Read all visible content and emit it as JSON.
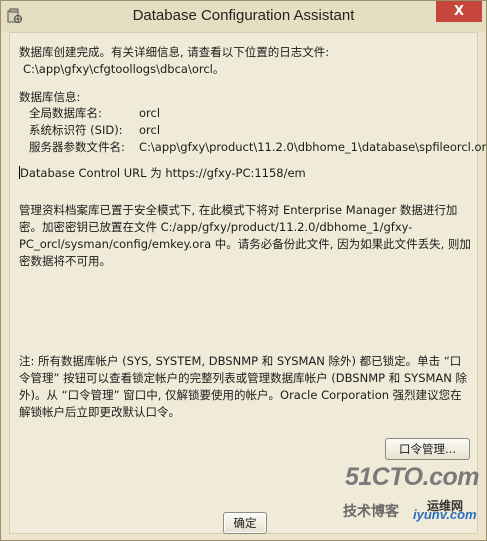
{
  "window": {
    "title": "Database Configuration Assistant",
    "close_glyph": "X"
  },
  "message": {
    "complete": "数据库创建完成。有关详细信息, 请查看以下位置的日志文件:",
    "log_path": "C:\\app\\gfxy\\cfgtoollogs\\dbca\\orcl。",
    "db_info_heading": "数据库信息:",
    "global_db_name_label": "全局数据库名:",
    "global_db_name_value": "orcl",
    "sid_label": "系统标识符 (SID):",
    "sid_value": "orcl",
    "spfile_label": "服务器参数文件名:",
    "spfile_value": "C:\\app\\gfxy\\product\\11.2.0\\dbhome_1\\database\\spfileorcl.ora",
    "em_url": "Database Control URL 为 https://gfxy-PC:1158/em",
    "repository_note": "管理资料档案库已置于安全模式下, 在此模式下将对 Enterprise Manager 数据进行加密。加密密钥已放置在文件 C:/app/gfxy/product/11.2.0/dbhome_1/gfxy-PC_orcl/sysman/config/emkey.ora 中。请务必备份此文件, 因为如果此文件丢失, 则加密数据将不可用。",
    "lock_note": "注: 所有数据库帐户 (SYS, SYSTEM, DBSNMP 和 SYSMAN 除外) 都已锁定。单击 “口令管理” 按钮可以查看锁定帐户的完整列表或管理数据库帐户 (DBSNMP 和 SYSMAN 除外)。从 “口令管理” 窗口中, 仅解锁要使用的帐户。Oracle Corporation 强烈建议您在解锁帐户后立即更改默认口令。"
  },
  "buttons": {
    "password_mgmt": "口令管理...",
    "ok": "确定"
  },
  "watermark": {
    "site": "51CTO.com",
    "tagline": "技术博客",
    "site2": "iyunv.com",
    "tag2": "运维网"
  },
  "colors": {
    "background": "#ece5cc",
    "close_button": "#c7463c"
  }
}
